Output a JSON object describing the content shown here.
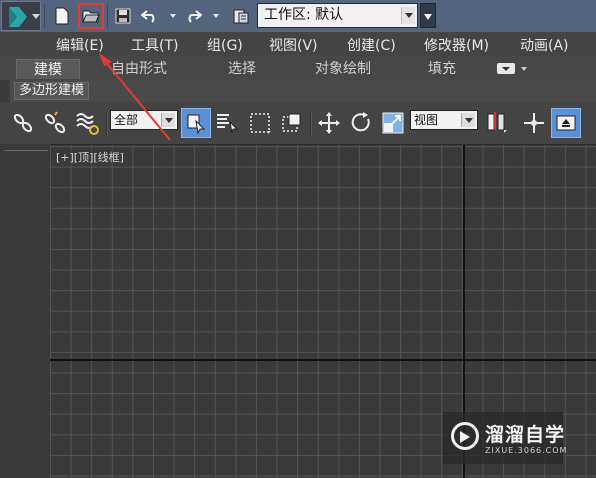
{
  "quick_access": {
    "workspace_value": "工作区: 默认",
    "buttons": [
      "new-scene",
      "open-file",
      "save-file",
      "undo",
      "redo",
      "project-folder"
    ]
  },
  "menu": {
    "items": [
      "编辑(E)",
      "工具(T)",
      "组(G)",
      "视图(V)",
      "创建(C)",
      "修改器(M)",
      "动画(A)"
    ]
  },
  "ribbon": {
    "tabs": [
      "建模",
      "自由形式",
      "选择",
      "对象绘制",
      "填充"
    ],
    "active_tab": "建模",
    "subpanel_label": "多边形建模"
  },
  "toolbar": {
    "selection_filter": "全部",
    "reference_coord": "视图"
  },
  "viewport": {
    "label": "[+][顶][线框]"
  },
  "watermark": {
    "brand": "溜溜自学",
    "url": "ZIXUE.3066.COM"
  },
  "colors": {
    "accent_highlight": "#e53935",
    "active_button": "#5b8fd6",
    "titlebar": "#54647c"
  }
}
